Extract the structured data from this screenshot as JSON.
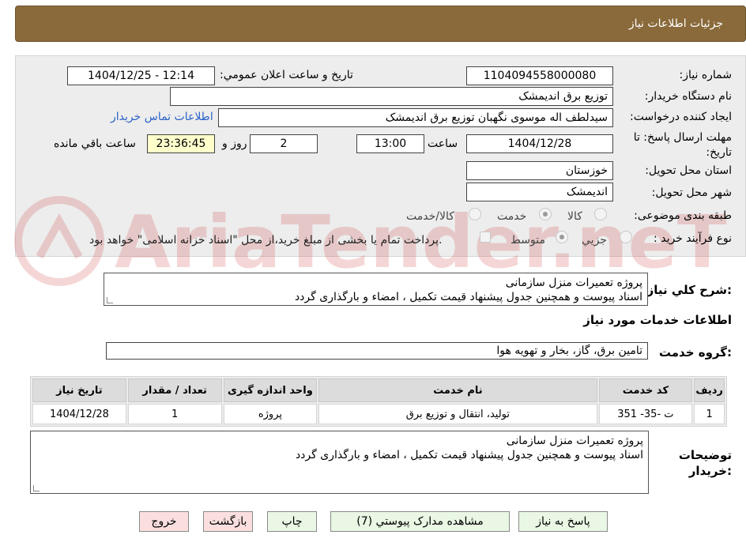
{
  "header": {
    "title": "جزئیات اطلاعات نیاز"
  },
  "fields": {
    "need_number_label": "شماره نیاز:",
    "need_number": "1104094558000080",
    "announce_label": "تاریخ و ساعت اعلان عمومي:",
    "announce_value": "1404/12/25 - 12:14",
    "buyer_org_label": "نام دستگاه خريدار:",
    "buyer_org": "توزیع برق اندیمشک",
    "creator_label": "ايجاد کننده درخواست:",
    "creator": "سیدلطف اله موسوی نگهبان توزیع برق اندیمشک",
    "contact_link": "اطلاعات تماس خريدار",
    "deadline_label": "مهلت ارسال پاسخ: تا تاریخ:",
    "deadline_date": "1404/12/28",
    "time_label": "ساعت",
    "deadline_time": "13:00",
    "days_value": "2",
    "days_label": "روز و",
    "remaining_time": "23:36:45",
    "remaining_label": "ساعت باقي مانده",
    "province_label": "استان محل تحويل:",
    "province": "خوزستان",
    "city_label": "شهر محل تحويل:",
    "city": "اندیمشک",
    "category_label": "طبقه بندی موضوعی:",
    "category_options": [
      "کالا",
      "خدمت",
      "کالا/خدمت"
    ],
    "process_label": "نوع فرآيند خريد :",
    "process_options": [
      "جزيي",
      "متوسط"
    ],
    "process_note": "پرداخت تمام یا بخشی از مبلغ خرید،از محل \"اسناد خزانه اسلامی\" خواهد بود."
  },
  "summary": {
    "label": "شرح کلي نياز:",
    "line1": "پروژه تعمیرات منزل سازمانی",
    "line2": "اسناد پیوست و همچنین جدول پیشنهاد قیمت تکمیل ، امضاء  و بارگذاری گردد"
  },
  "services": {
    "section_title": "اطلاعات خدمات مورد نياز",
    "group_label": "گروه خدمت:",
    "group_value": "تامین برق، گاز، بخار و تهویه هوا",
    "columns": [
      "رديف",
      "کد خدمت",
      "نام خدمت",
      "واحد اندازه گيری",
      "تعداد / مقدار",
      "تاريخ نياز"
    ],
    "rows": [
      [
        "1",
        "ت -35- 351",
        "تولید، انتقال و توزیع برق",
        "پروژه",
        "1",
        "1404/12/28"
      ]
    ]
  },
  "buyer_notes": {
    "label_line1": "توضيحات",
    "label_line2": "خريدار:",
    "line1": "پروژه تعمیرات منزل سازمانی",
    "line2": "اسناد پیوست و همچنین جدول پیشنهاد قیمت تکمیل ، امضاء  و بارگذاری گردد"
  },
  "buttons": {
    "reply": "پاسخ به نياز",
    "attachments": "مشاهده مدارک پيوستي (7)",
    "print": "چاپ",
    "back": "بازگشت",
    "exit": "خروج"
  },
  "watermark": {
    "text": "AriaTender.neT"
  },
  "colors": {
    "header_bg": "#8a6a3a",
    "panel_bg": "#ededed",
    "link": "#2a62c9",
    "remaining_bg": "#ffffcc"
  }
}
